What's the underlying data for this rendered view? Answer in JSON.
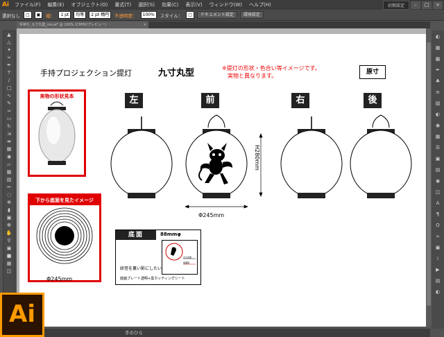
{
  "menubar": {
    "logo": "Ai",
    "menus": [
      "ファイル(F)",
      "編集(E)",
      "オブジェクト(O)",
      "書式(T)",
      "選択(S)",
      "効果(C)",
      "表示(V)",
      "ウィンドウ(W)",
      "ヘルプ(H)"
    ],
    "workspace": "初期設定",
    "win_min": "–",
    "win_max": "□",
    "win_close": "×"
  },
  "controlbar": {
    "selection": "選択なし",
    "stroke_label": "線：",
    "stroke_weight": "1 pt",
    "line_style": "均等",
    "brush": "2 pt 楕円",
    "opacity_label": "不透明度：",
    "opacity": "100%",
    "style_label": "スタイル：",
    "doc_settings": "ドキュメント設定",
    "env_settings": "環境設定"
  },
  "tab": {
    "title": "手持ち_九寸丸型_rev.ai* @ 100% (CMYK/プレビュー)",
    "close": "×"
  },
  "statusbar": {
    "hint": "手のひら"
  },
  "artboard": {
    "title": "手持プロジェクション提灯",
    "model": "九寸丸型",
    "note": "※提灯の形状・色合い等イメージです。\n　実物と異なります。",
    "scale": "原寸",
    "views": [
      "左",
      "前",
      "右",
      "後"
    ],
    "sample_header": "実物の形状見本",
    "bottom_view_header": "下から底面を見たイメージ",
    "dim_width": "Φ245mm",
    "dim_height": "H280mm",
    "dim_bottom": "Φ245mm",
    "bottom_panel": {
      "header": "底面",
      "diameter": "88mmφ",
      "caption": "妖怪を裏い影にしたい",
      "spec": "底面プレート透明+黒カッティングシート",
      "inset_label1": "九寸丸型",
      "inset_label2": "底面部"
    }
  },
  "colors": {
    "accent": "#ff9a00",
    "warning": "#e00000",
    "app_bg": "#535353"
  }
}
